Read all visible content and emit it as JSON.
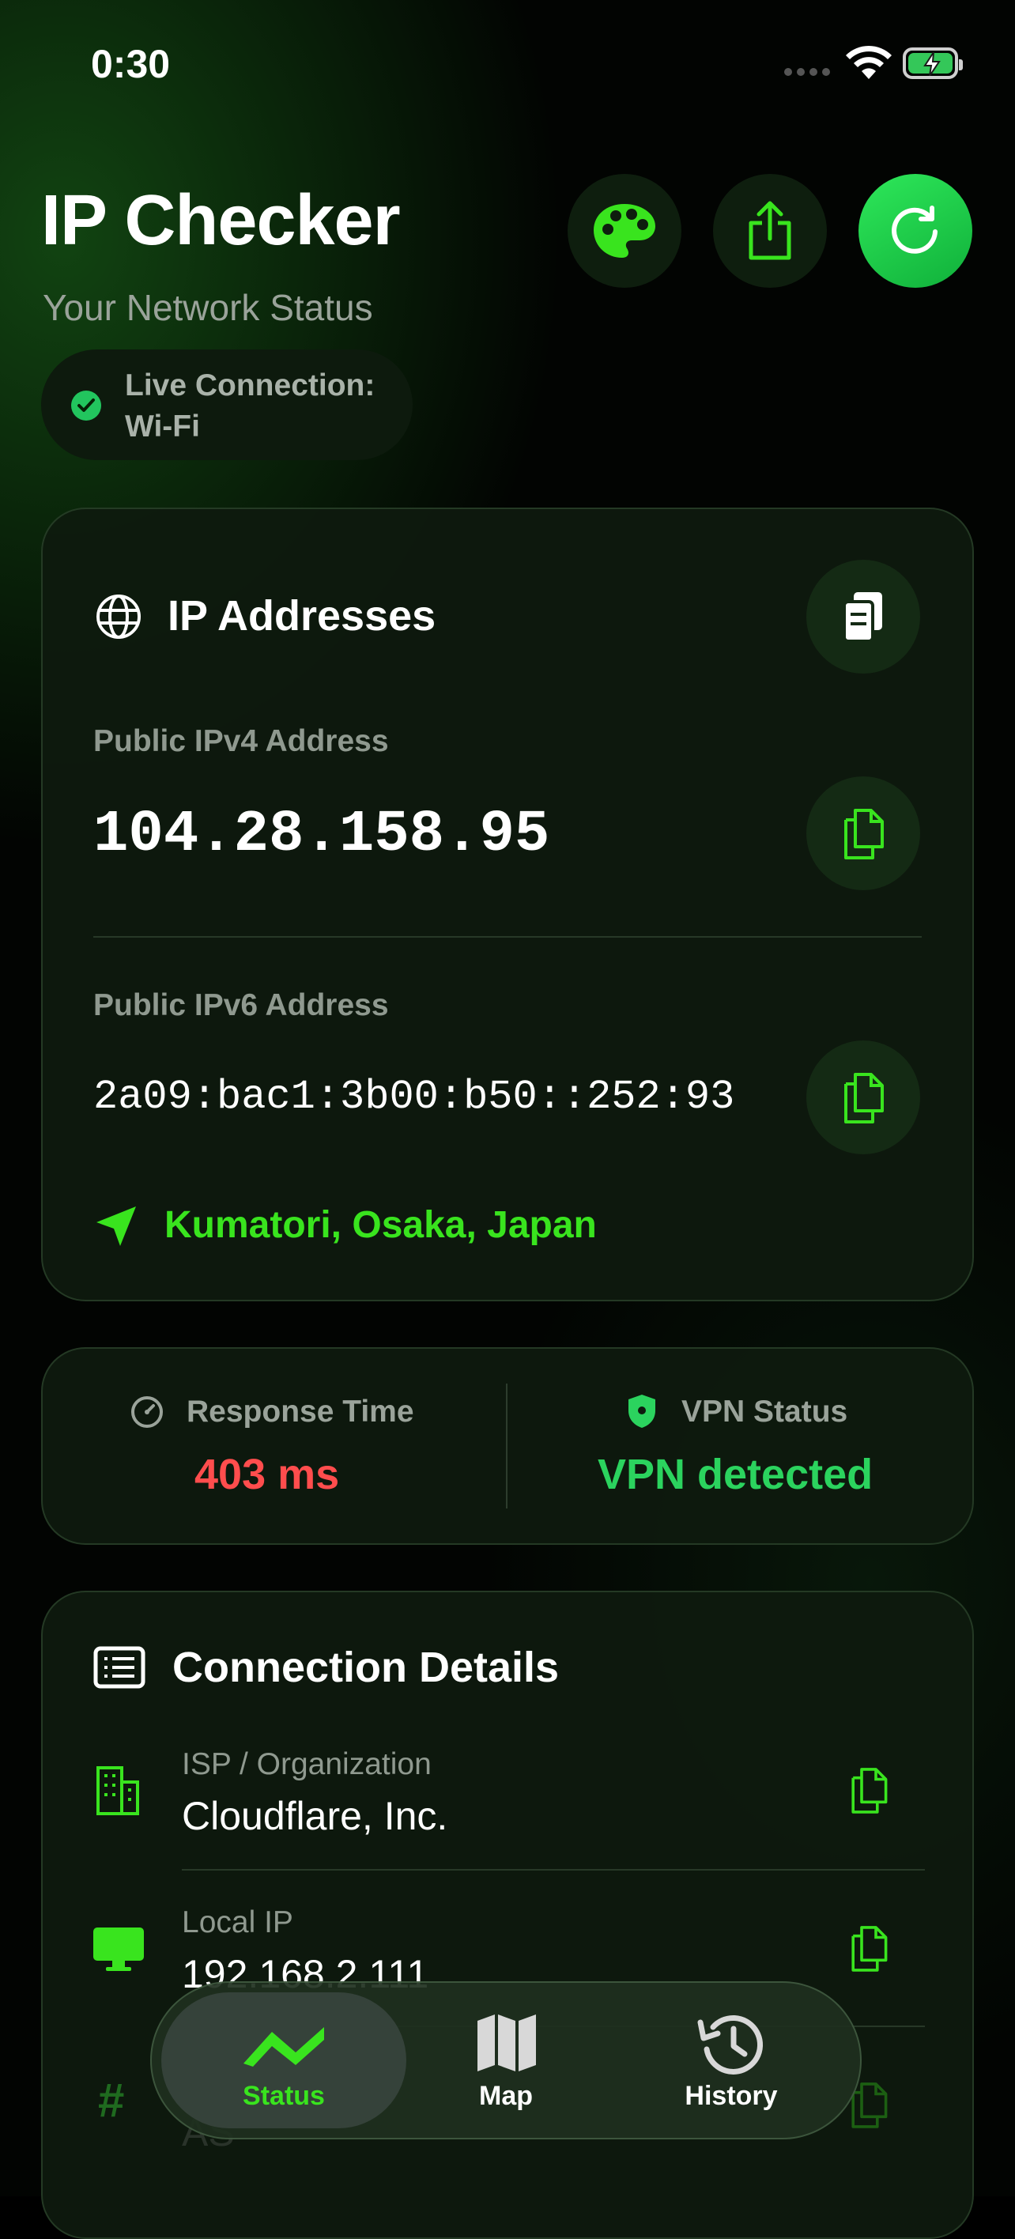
{
  "status_bar": {
    "time": "0:30"
  },
  "header": {
    "title": "IP Checker",
    "subtitle": "Your Network Status",
    "connection_status": "Live Connection: Wi-Fi",
    "connection_line1": "Live Connection:",
    "connection_line2": "Wi-Fi"
  },
  "ip_card": {
    "title": "IP Addresses",
    "ipv4_label": "Public IPv4 Address",
    "ipv4_value": "104.28.158.95",
    "ipv6_label": "Public IPv6 Address",
    "ipv6_value": "2a09:bac1:3b00:b50::252:93",
    "location": "Kumatori, Osaka, Japan"
  },
  "stats": {
    "response_label": "Response Time",
    "response_value": "403 ms",
    "vpn_label": "VPN Status",
    "vpn_value": "VPN detected"
  },
  "connection_details": {
    "title": "Connection Details",
    "items": [
      {
        "label": "ISP / Organization",
        "value": "Cloudflare, Inc."
      },
      {
        "label": "Local IP",
        "value": "192.168.2.111"
      },
      {
        "label": "AS",
        "value": ""
      }
    ]
  },
  "tabs": [
    {
      "label": "Status",
      "active": true
    },
    {
      "label": "Map",
      "active": false
    },
    {
      "label": "History",
      "active": false
    }
  ],
  "colors": {
    "accent_green": "#39e41e",
    "response_red": "#ff4d4d",
    "vpn_green": "#2bd35e"
  }
}
